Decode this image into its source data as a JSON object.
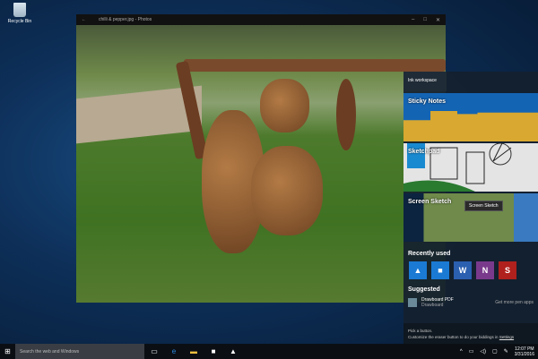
{
  "desktop": {
    "recycle_bin": "Recycle Bin"
  },
  "photos_window": {
    "title": "chilli & pepper.jpg - Photos",
    "back": "←",
    "minimize": "–",
    "maximize": "□",
    "close": "✕"
  },
  "ink_workspace": {
    "title": "Ink workspace",
    "cards": [
      {
        "label": "Sticky Notes"
      },
      {
        "label": "Sketchpad"
      },
      {
        "label": "Screen Sketch",
        "tooltip": "Screen Sketch"
      }
    ],
    "recently_used_label": "Recently used",
    "recent_apps": [
      {
        "name": "Photos",
        "color": "#1a7ad4",
        "glyph": "▲"
      },
      {
        "name": "Fresh Paint",
        "color": "#1a7ad4",
        "glyph": "■"
      },
      {
        "name": "Word",
        "color": "#2b5fb0",
        "glyph": "W"
      },
      {
        "name": "OneNote",
        "color": "#7a3a8c",
        "glyph": "N"
      },
      {
        "name": "Sketchable",
        "color": "#b0201c",
        "glyph": "S"
      }
    ],
    "suggested_label": "Suggested",
    "suggested": {
      "name": "Drawboard PDF",
      "publisher": "Drawboard",
      "more": "Get more pen apps"
    },
    "tip_line1": "Pick a button.",
    "tip_line2": "Customize the eraser button to do your biddings in",
    "tip_link": "Settings"
  },
  "taskbar": {
    "search_placeholder": "Search the web and Windows",
    "time": "12:07 PM",
    "date": "3/31/2016"
  }
}
